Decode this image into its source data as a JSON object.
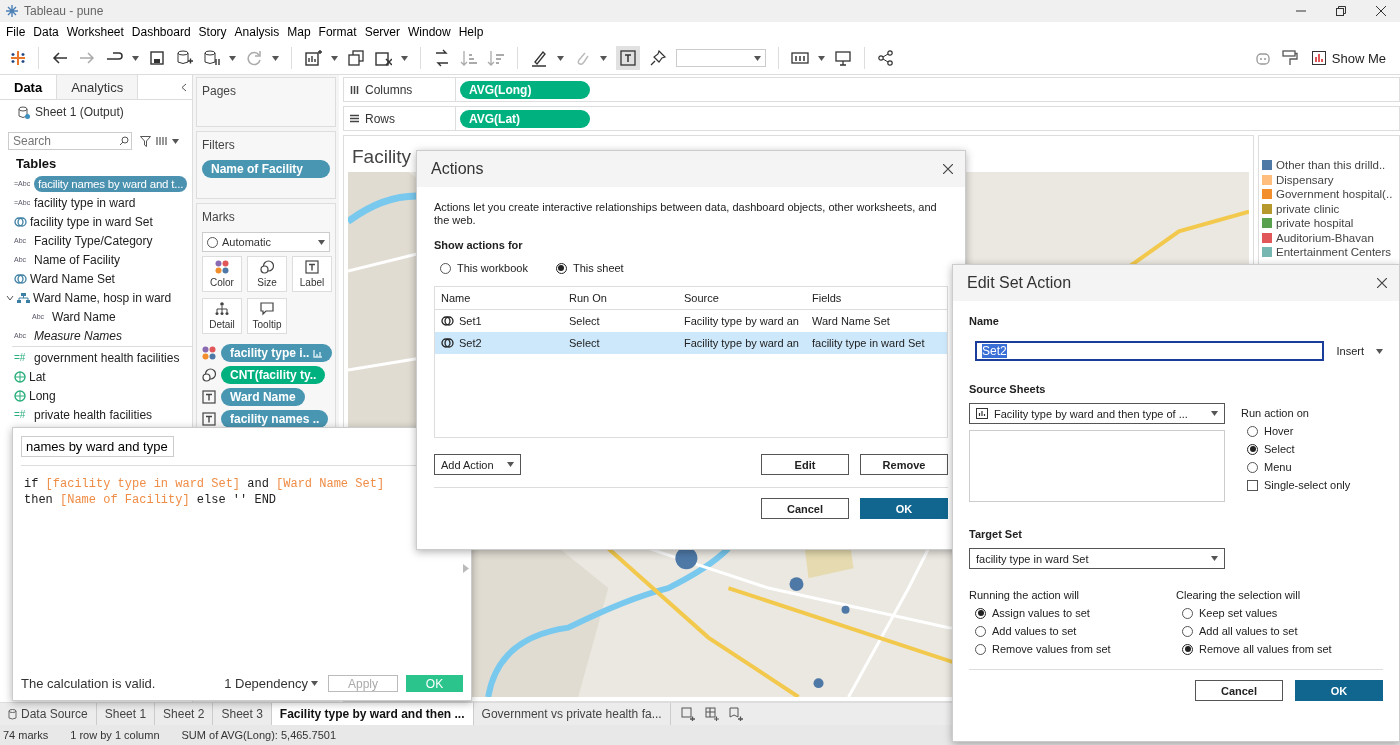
{
  "window": {
    "title": "Tableau - pune"
  },
  "menu": [
    "File",
    "Data",
    "Worksheet",
    "Dashboard",
    "Story",
    "Analysis",
    "Map",
    "Format",
    "Server",
    "Window",
    "Help"
  ],
  "toolbar": {
    "show_me": "Show Me"
  },
  "data_pane": {
    "tabs": [
      {
        "label": "Data",
        "selected": true
      },
      {
        "label": "Analytics",
        "selected": false
      }
    ],
    "source": "Sheet 1 (Output)",
    "search": {
      "placeholder": "Search"
    },
    "tables_heading": "Tables",
    "fields": [
      {
        "kind": "calc",
        "type_label": "=Abc",
        "label": "facility names by ward and t...",
        "selected": true
      },
      {
        "kind": "calc",
        "type_label": "=Abc",
        "label": "facility type in ward",
        "selected": false
      },
      {
        "kind": "set",
        "label": "facility type in ward Set",
        "selected": false
      },
      {
        "kind": "abc",
        "type_label": "Abc",
        "label": "Facility Type/Category",
        "selected": false
      },
      {
        "kind": "abc",
        "type_label": "Abc",
        "label": "Name of Facility",
        "selected": false
      },
      {
        "kind": "set",
        "label": "Ward Name Set",
        "selected": false
      },
      {
        "kind": "hierarchy",
        "label": "Ward Name, hosp in ward",
        "selected": false,
        "expanded": true,
        "children": [
          {
            "kind": "abc",
            "type_label": "Abc",
            "label": "Ward Name",
            "selected": false
          }
        ]
      },
      {
        "kind": "measure-names",
        "type_label": "Abc",
        "label": "Measure Names",
        "selected": false
      },
      {
        "kind": "measure",
        "type_label": "=#",
        "label": "government health facilities",
        "selected": false
      },
      {
        "kind": "geo",
        "label": "Lat",
        "selected": false
      },
      {
        "kind": "geo",
        "label": "Long",
        "selected": false
      },
      {
        "kind": "measure",
        "type_label": "=#",
        "label": "private health facilities",
        "selected": false
      }
    ]
  },
  "shelves": {
    "pages": "Pages",
    "filters": {
      "title": "Filters",
      "pills": [
        {
          "label": "Name of Facility",
          "measure": false
        }
      ]
    },
    "marks": {
      "title": "Marks",
      "mark_type": "Automatic",
      "cards": [
        {
          "kind": "color",
          "label": "Color"
        },
        {
          "kind": "size",
          "label": "Size"
        },
        {
          "kind": "label",
          "label": "Label"
        },
        {
          "kind": "detail",
          "label": "Detail"
        },
        {
          "kind": "tooltip",
          "label": "Tooltip"
        }
      ],
      "pills": [
        {
          "kind": "color",
          "label": "facility type i..",
          "measure": false,
          "sorted": true
        },
        {
          "kind": "size",
          "label": "CNT(facility ty..",
          "measure": true,
          "sorted": false
        },
        {
          "kind": "label",
          "label": "Ward Name",
          "measure": false,
          "sorted": false
        },
        {
          "kind": "label",
          "label": "facility names ..",
          "measure": false,
          "sorted": false
        }
      ]
    }
  },
  "columns": {
    "label": "Columns",
    "pills": [
      {
        "label": "AVG(Long)",
        "measure": true
      }
    ]
  },
  "rows": {
    "label": "Rows",
    "pills": [
      {
        "label": "AVG(Lat)",
        "measure": true
      }
    ]
  },
  "view": {
    "title": "Facility",
    "legend": [
      {
        "label": "Other than this drilld..",
        "color": "#4e79a7"
      },
      {
        "label": "Dispensary",
        "color": "#ffbe7d"
      },
      {
        "label": "Government hospital(..",
        "color": "#f28e2b"
      },
      {
        "label": "private clinic",
        "color": "#b6992d"
      },
      {
        "label": "private hospital",
        "color": "#59a14f"
      },
      {
        "label": "Auditorium-Bhavan",
        "color": "#e15759"
      },
      {
        "label": "Entertainment Centers",
        "color": "#76b7b2"
      }
    ]
  },
  "sheet_tabs": [
    {
      "label": "Data Source",
      "kind": "data-source",
      "selected": false
    },
    {
      "label": "Sheet 1",
      "kind": "sheet",
      "selected": false
    },
    {
      "label": "Sheet 2",
      "kind": "sheet",
      "selected": false
    },
    {
      "label": "Sheet 3",
      "kind": "sheet",
      "selected": false
    },
    {
      "label": "Facility type by ward and then ...",
      "kind": "sheet",
      "selected": true
    },
    {
      "label": "Government vs private health fa...",
      "kind": "sheet",
      "selected": false
    }
  ],
  "status_bar": [
    "74 marks",
    "1 row by 1 column",
    "SUM of AVG(Long): 5,465.7501"
  ],
  "calc_editor": {
    "name": "names by ward and type",
    "code": [
      [
        {
          "text": "if ",
          "kind": "keyword"
        },
        {
          "text": "[facility type in ward Set]",
          "kind": "field"
        },
        {
          "text": " and ",
          "kind": "keyword"
        },
        {
          "text": "[Ward Name Set]",
          "kind": "field"
        }
      ],
      [
        {
          "text": "then ",
          "kind": "keyword"
        },
        {
          "text": "[Name of Facility]",
          "kind": "field"
        },
        {
          "text": " else '' END",
          "kind": "keyword"
        }
      ]
    ],
    "status": "The calculation is valid.",
    "dependency": "1 Dependency",
    "apply": {
      "label": "Apply",
      "disabled": true
    },
    "ok": "OK"
  },
  "actions_dialog": {
    "title": "Actions",
    "description": "Actions let you create interactive relationships between data, dashboard objects, other worksheets, and the web.",
    "show_for_label": "Show actions for",
    "scope": [
      {
        "label": "This workbook",
        "selected": false
      },
      {
        "label": "This sheet",
        "selected": true
      }
    ],
    "columns": [
      "Name",
      "Run On",
      "Source",
      "Fields"
    ],
    "rows": [
      {
        "cells": [
          "Set1",
          "Select",
          "Facility type by ward an",
          "Ward Name Set"
        ],
        "selected": false
      },
      {
        "cells": [
          "Set2",
          "Select",
          "Facility type by ward an",
          "facility type in ward Set"
        ],
        "selected": true
      }
    ],
    "add_action": "Add Action",
    "edit": "Edit",
    "remove": "Remove",
    "cancel": "Cancel",
    "ok": "OK"
  },
  "edit_set_action": {
    "title": "Edit Set Action",
    "name_label": "Name",
    "name_value": "Set2",
    "name_highlighted": true,
    "insert": "Insert",
    "source_label": "Source Sheets",
    "source_sheet": "Facility type by ward and then type of ...",
    "run_on_label": "Run action on",
    "run_on": [
      {
        "label": "Hover",
        "selected": false
      },
      {
        "label": "Select",
        "selected": true
      },
      {
        "label": "Menu",
        "selected": false
      }
    ],
    "single_select": {
      "label": "Single-select only",
      "checked": false
    },
    "target_label": "Target Set",
    "target_set": "facility type in ward Set",
    "running_label": "Running the action will",
    "running": [
      {
        "label": "Assign values to set",
        "selected": true
      },
      {
        "label": "Add values to set",
        "selected": false
      },
      {
        "label": "Remove values from set",
        "selected": false
      }
    ],
    "clearing_label": "Clearing the selection will",
    "clearing": [
      {
        "label": "Keep set values",
        "selected": false
      },
      {
        "label": "Add all values to set",
        "selected": false
      },
      {
        "label": "Remove all values from set",
        "selected": true
      }
    ],
    "cancel": "Cancel",
    "ok": "OK"
  }
}
